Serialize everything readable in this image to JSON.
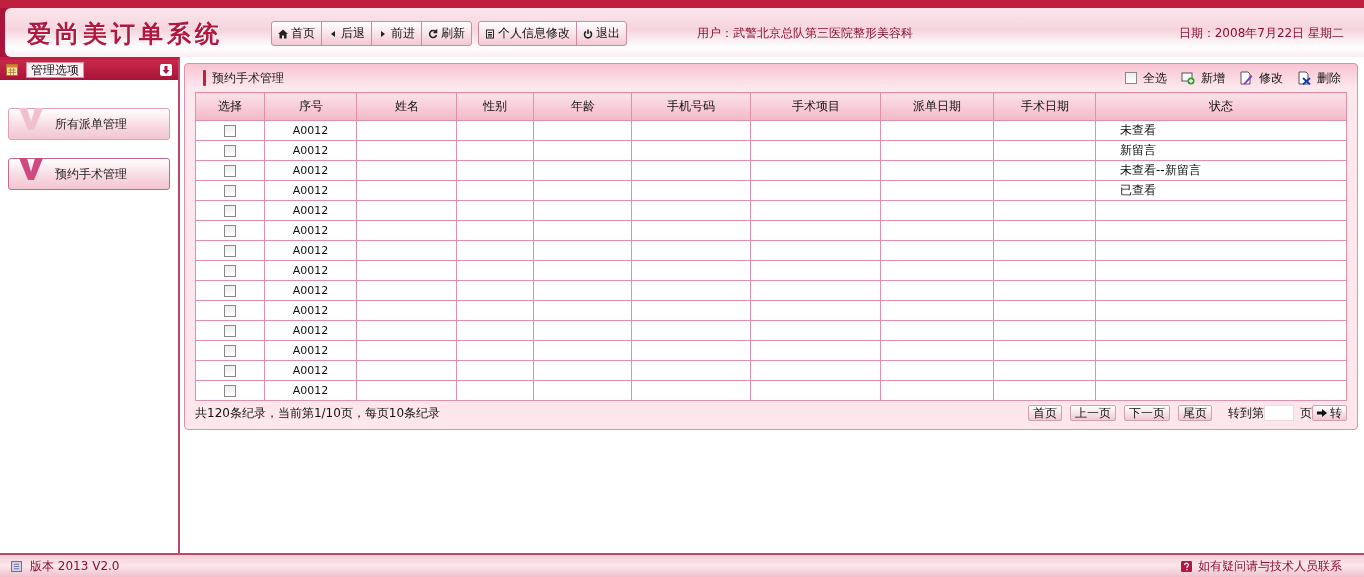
{
  "header": {
    "logo": "爱尚美订单系统",
    "nav_groups": [
      [
        {
          "label": "首页",
          "kind": "home"
        },
        {
          "label": "后退",
          "kind": "back"
        },
        {
          "label": "前进",
          "kind": "forward"
        },
        {
          "label": "刷新",
          "kind": "refresh"
        }
      ],
      [
        {
          "label": "个人信息修改",
          "kind": "profile"
        },
        {
          "label": "退出",
          "kind": "exit"
        }
      ]
    ],
    "user": "用户：武警北京总队第三医院整形美容科",
    "date": "日期：2008年7月22日  星期二"
  },
  "sidebar": {
    "title": "管理选项",
    "items": [
      {
        "label": "所有派单管理",
        "selected": false
      },
      {
        "label": "预约手术管理",
        "selected": true
      }
    ]
  },
  "panel": {
    "title": "预约手术管理",
    "select_all": {
      "label": "全选",
      "checked": false
    },
    "actions": [
      {
        "label": "新增",
        "kind": "add"
      },
      {
        "label": "修改",
        "kind": "edit"
      },
      {
        "label": "删除",
        "kind": "delete"
      }
    ],
    "table": {
      "columns": [
        "选择",
        "序号",
        "姓名",
        "性别",
        "年龄",
        "手机号码",
        "手术项目",
        "派单日期",
        "手术日期",
        "状态"
      ],
      "rows": [
        {
          "checked": false,
          "id": "A0012",
          "status": "未查看"
        },
        {
          "checked": false,
          "id": "A0012",
          "status": "新留言"
        },
        {
          "checked": false,
          "id": "A0012",
          "status": "未查看--新留言"
        },
        {
          "checked": false,
          "id": "A0012",
          "status": "已查看"
        },
        {
          "checked": false,
          "id": "A0012"
        },
        {
          "checked": false,
          "id": "A0012"
        },
        {
          "checked": false,
          "id": "A0012"
        },
        {
          "checked": false,
          "id": "A0012"
        },
        {
          "checked": false,
          "id": "A0012"
        },
        {
          "checked": false,
          "id": "A0012"
        },
        {
          "checked": false,
          "id": "A0012"
        },
        {
          "checked": false,
          "id": "A0012"
        },
        {
          "checked": false,
          "id": "A0012"
        },
        {
          "checked": false,
          "id": "A0012"
        }
      ]
    },
    "summary": "共120条纪录，当前第1/10页，每页10条纪录",
    "pager": {
      "buttons": [
        "首页",
        "上一页",
        "下一页",
        "尾页"
      ],
      "goto_label": "转到第",
      "page_unit": "页",
      "go": "转"
    }
  },
  "footer": {
    "version": "版本 2013 V2.0",
    "help": "如有疑问请与技术人员联系"
  }
}
